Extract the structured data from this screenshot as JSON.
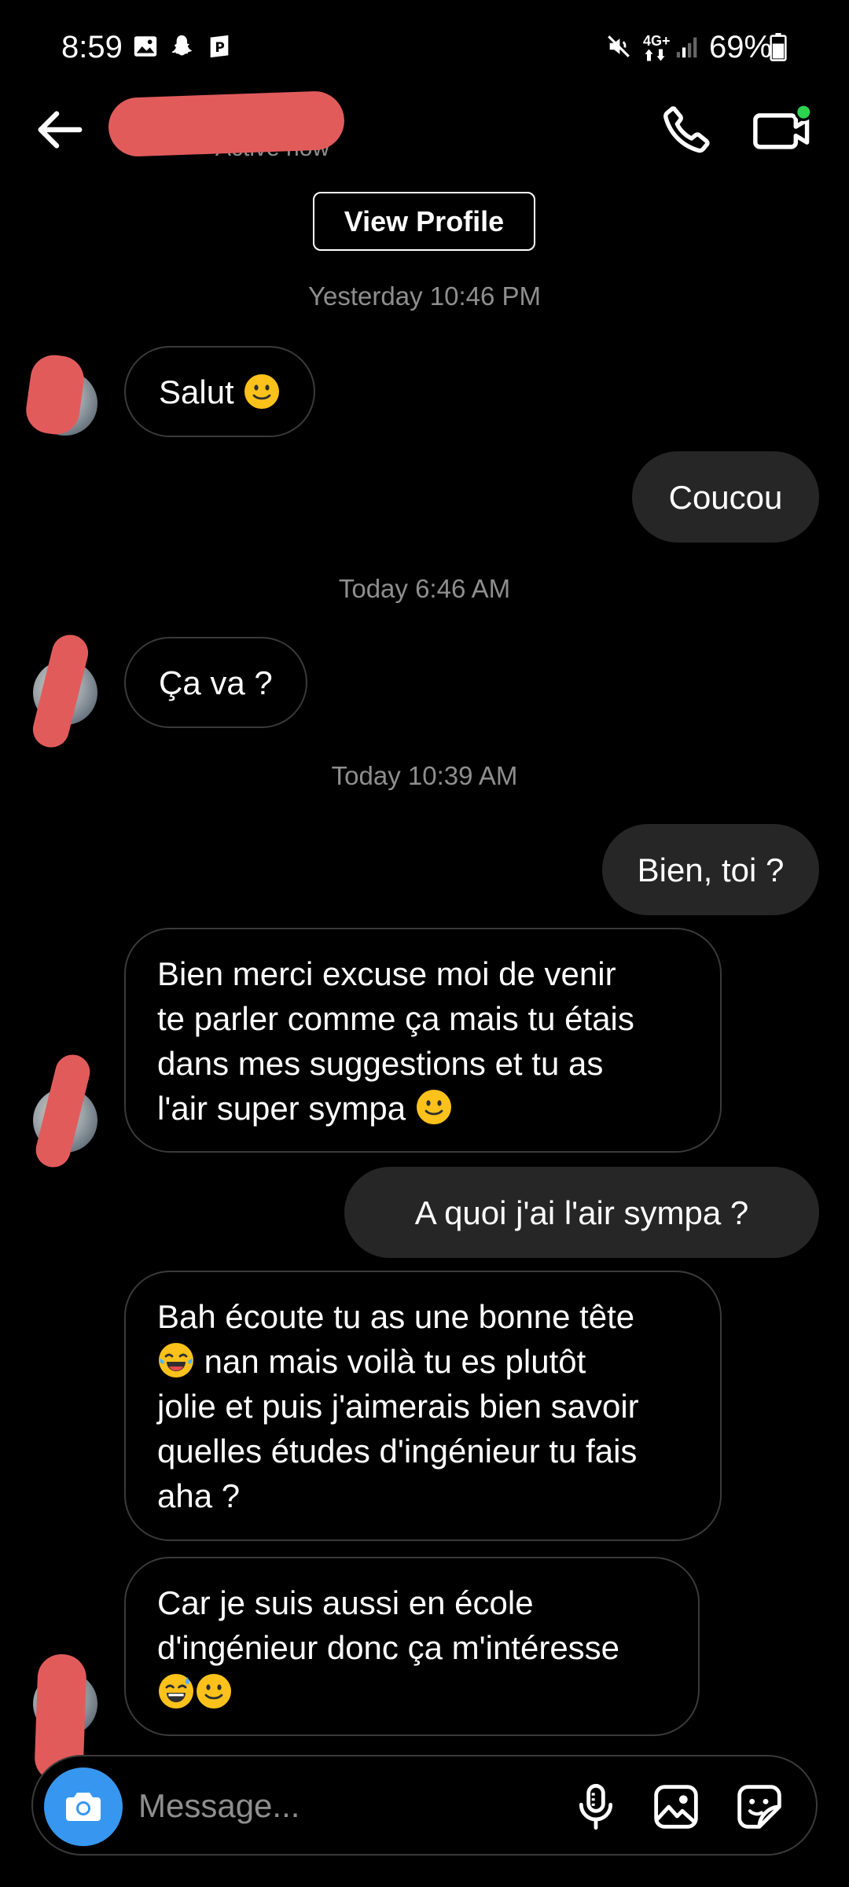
{
  "status_bar": {
    "time": "8:59",
    "battery": "69%",
    "network": "4G+"
  },
  "header": {
    "status_text": "Active now"
  },
  "view_profile_label": "View Profile",
  "messages": [
    {
      "type": "timestamp",
      "text": "Yesterday 10:46 PM"
    },
    {
      "type": "incoming",
      "text": "Salut",
      "emoji": "slight-smile"
    },
    {
      "type": "outgoing",
      "text": "Coucou"
    },
    {
      "type": "timestamp",
      "text": "Today 6:46 AM"
    },
    {
      "type": "incoming",
      "text": "Ça va ?"
    },
    {
      "type": "timestamp",
      "text": "Today 10:39 AM"
    },
    {
      "type": "outgoing",
      "text": "Bien, toi ?"
    },
    {
      "type": "incoming",
      "lines": [
        "Bien merci excuse moi de venir",
        "te parler comme ça mais tu étais",
        "dans mes suggestions et tu as",
        "l'air super sympa"
      ],
      "emoji": "slight-smile"
    },
    {
      "type": "outgoing",
      "text": "A quoi j'ai l'air sympa ?"
    },
    {
      "type": "incoming",
      "lines": [
        "Bah écoute tu as une bonne tête",
        "nan mais voilà tu es plutôt",
        "jolie et puis j'aimerais bien savoir",
        "quelles études d'ingénieur tu fais",
        "aha ?"
      ],
      "emoji": "tears-of-joy"
    },
    {
      "type": "incoming",
      "lines": [
        "Car je suis aussi en école",
        "d'ingénieur donc ça m'intéresse"
      ],
      "emoji": "sweat-smile slight-smile"
    }
  ],
  "composer": {
    "placeholder": "Message..."
  },
  "colors": {
    "background": "#000000",
    "outgoing_bubble": "#262626",
    "incoming_border": "#3a3a3a",
    "camera_button": "#3797f0",
    "online_dot": "#2bd34f",
    "redaction": "#e25b5b"
  }
}
